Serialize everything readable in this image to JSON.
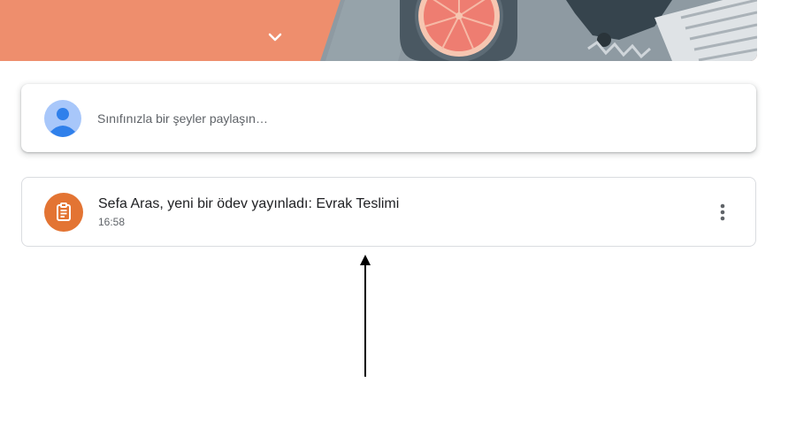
{
  "banner": {
    "accent_color": "#ee8e6d",
    "expand_icon": "chevron-down-icon"
  },
  "compose": {
    "avatar_icon": "default-avatar-icon",
    "placeholder": "Sınıfınızla bir şeyler paylaşın…"
  },
  "stream": {
    "items": [
      {
        "icon": "assignment-icon",
        "icon_color": "#e37433",
        "title": "Sefa Aras, yeni bir ödev yayınladı: Evrak Teslimi",
        "time": "16:58",
        "menu_icon": "more-vert-icon"
      }
    ]
  }
}
